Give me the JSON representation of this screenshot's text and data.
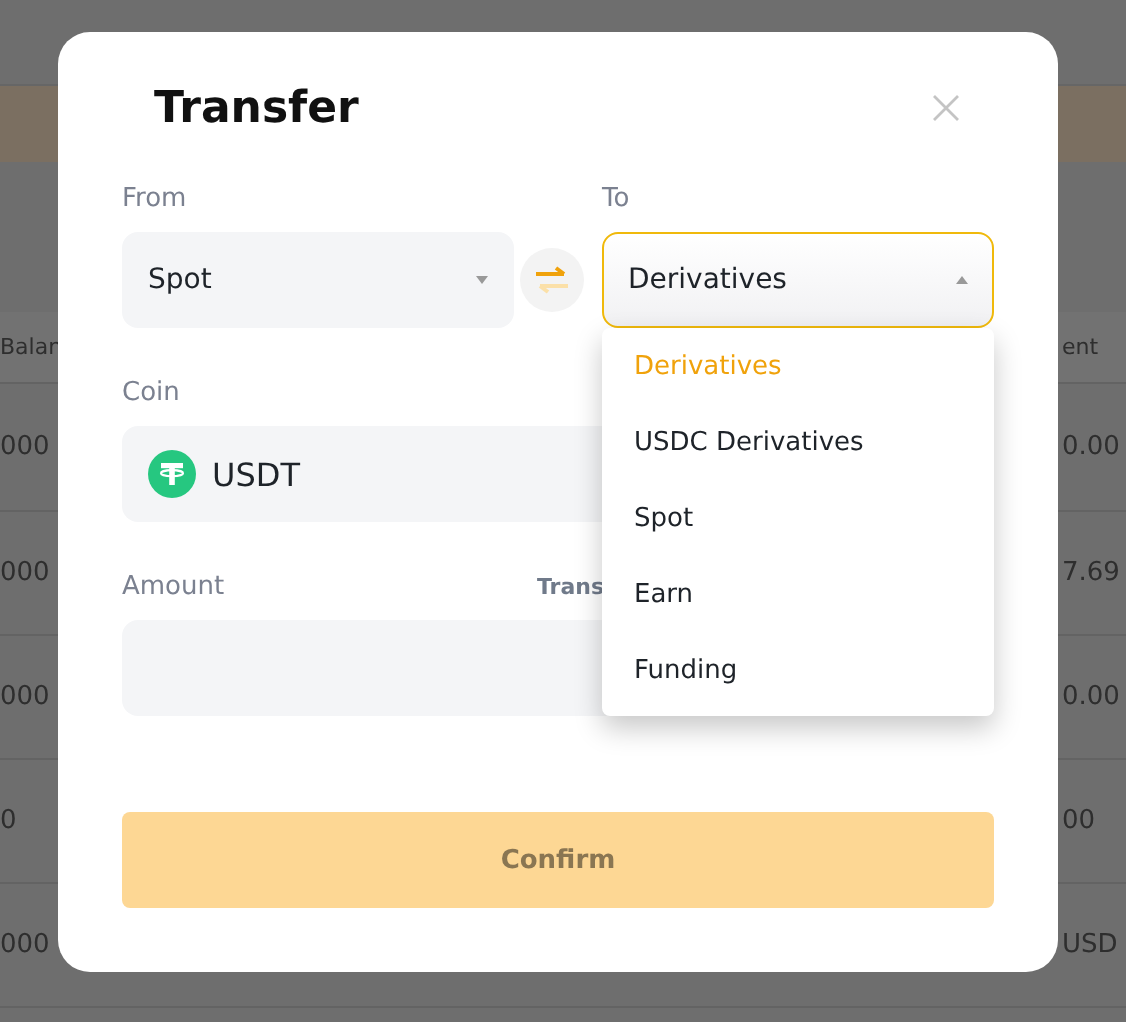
{
  "background_table": {
    "header": [
      "Balan",
      "ent"
    ],
    "rows": [
      {
        "column_1": "000",
        "column_2": "0.00"
      },
      {
        "column_1": "000",
        "column_2": "7.69"
      },
      {
        "column_1": "000",
        "column_2": "0.00"
      },
      {
        "column_1": "0",
        "column_2": "00"
      },
      {
        "column_1": "000",
        "column_2": "USD"
      }
    ]
  },
  "dialog": {
    "title": "Transfer",
    "from": {
      "label": "From",
      "value": "Spot"
    },
    "to": {
      "label": "To",
      "value": "Derivatives",
      "expanded": true,
      "options": [
        {
          "label": "Derivatives",
          "selected": true
        },
        {
          "label": "USDC Derivatives",
          "selected": false
        },
        {
          "label": "Spot",
          "selected": false
        },
        {
          "label": "Earn",
          "selected": false
        },
        {
          "label": "Funding",
          "selected": false
        }
      ]
    },
    "coin": {
      "label": "Coin",
      "value": "USDT"
    },
    "amount": {
      "label": "Amount",
      "hint": "Trans"
    },
    "confirm": {
      "label": "Confirm",
      "disabled": true
    }
  }
}
